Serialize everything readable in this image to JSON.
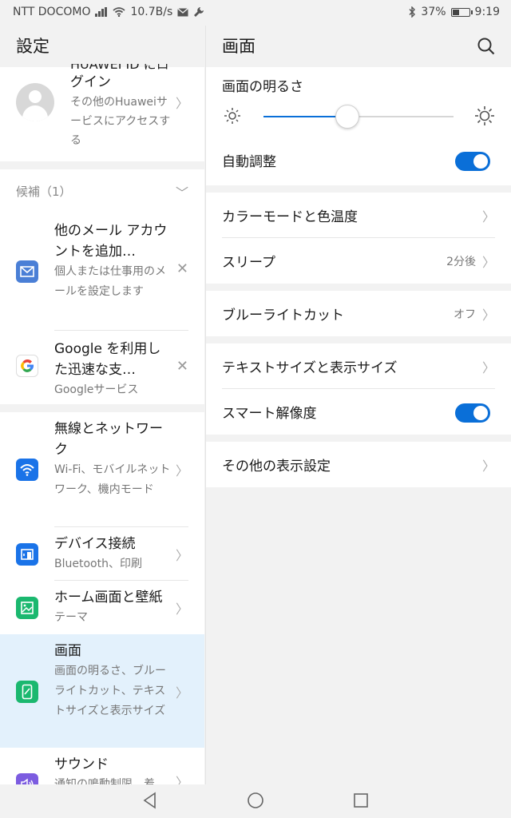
{
  "status": {
    "carrier": "NTT DOCOMO",
    "speed": "10.7B/s",
    "battery": "37%",
    "time": "9:19"
  },
  "left": {
    "title": "設定",
    "account": {
      "cut_text": "HUAWEI ID にロ",
      "title": "グイン",
      "subtitle": "その他のHuaweiサービスにアクセスする"
    },
    "suggestions_label": "候補（1）",
    "suggestions": [
      {
        "title": "他のメール アカウントを追加…",
        "subtitle": "個人または仕事用のメールを設定します"
      },
      {
        "title": "Google を利用した迅速な支…",
        "subtitle": "Googleサービス"
      }
    ],
    "items": [
      {
        "title": "無線とネットワーク",
        "subtitle": "Wi-Fi、モバイルネットワーク、機内モード"
      },
      {
        "title": "デバイス接続",
        "subtitle": "Bluetooth、印刷"
      },
      {
        "title": "ホーム画面と壁紙",
        "subtitle": "テーマ"
      },
      {
        "title": "画面",
        "subtitle": "画面の明るさ、ブルーライトカット、テキストサイズと表示サイズ"
      },
      {
        "title": "サウンド",
        "subtitle": "通知の鳴動制限、着"
      }
    ]
  },
  "right": {
    "title": "画面",
    "brightness_label": "画面の明るさ",
    "brightness_level": 0.44,
    "auto_adjust_label": "自動調整",
    "auto_adjust_on": true,
    "color_mode_label": "カラーモードと色温度",
    "sleep_label": "スリープ",
    "sleep_value": "2分後",
    "blue_light_label": "ブルーライトカット",
    "blue_light_value": "オフ",
    "text_size_label": "テキストサイズと表示サイズ",
    "smart_res_label": "スマート解像度",
    "smart_res_on": true,
    "other_label": "その他の表示設定"
  },
  "colors": {
    "accent": "#0a6fd8",
    "selected_bg": "#e3f1fc",
    "mail_icon": "#4a7fd6",
    "wifi_icon": "#1a73e8",
    "device_icon": "#1a73e8",
    "home_icon": "#1bb86f",
    "display_icon": "#1bb86f",
    "sound_icon": "#7c5ce0"
  }
}
